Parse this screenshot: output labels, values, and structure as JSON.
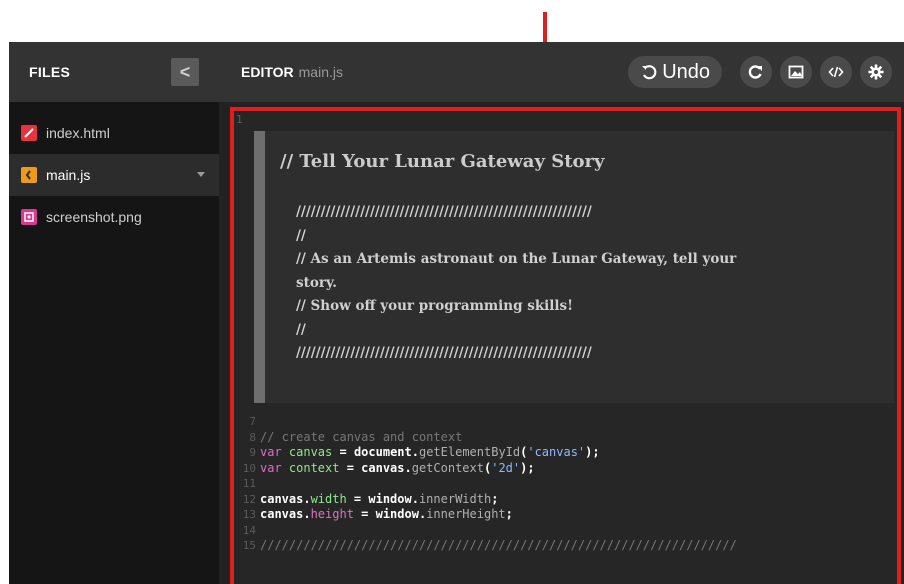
{
  "sidebar": {
    "title": "FILES",
    "collapse_glyph": "<",
    "files": [
      {
        "name": "index.html",
        "icon": "html-file-icon",
        "color": "#e8323c",
        "active": false
      },
      {
        "name": "main.js",
        "icon": "js-file-icon",
        "color": "#f09a1a",
        "active": true
      },
      {
        "name": "screenshot.png",
        "icon": "image-file-icon",
        "color": "#d6398f",
        "active": false
      }
    ]
  },
  "editor": {
    "label": "EDITOR",
    "filename": "main.js",
    "undo_label": "Undo",
    "tools": [
      "refresh-icon",
      "image-icon",
      "code-icon",
      "gear-icon"
    ]
  },
  "code": {
    "first_line_number": "1",
    "comment_title": "// Tell Your Lunar Gateway Story",
    "comment_lines": [
      "////////////////////////////////////////////////////////////",
      "//",
      "// As an Artemis astronaut on the Lunar Gateway, tell your",
      "story.",
      "// Show off your programming skills!",
      "//",
      "////////////////////////////////////////////////////////////"
    ],
    "lines": [
      {
        "n": "7",
        "parts": []
      },
      {
        "n": "8",
        "parts": [
          {
            "c": "c-com",
            "t": "// create canvas and context"
          }
        ]
      },
      {
        "n": "9",
        "parts": [
          {
            "c": "c-kw",
            "t": "var "
          },
          {
            "c": "c-var",
            "t": "canvas"
          },
          {
            "c": "c-punc",
            "t": " = document."
          },
          {
            "c": "c-fn",
            "t": "getElementById"
          },
          {
            "c": "c-punc",
            "t": "("
          },
          {
            "c": "c-str",
            "t": "'canvas'"
          },
          {
            "c": "c-punc",
            "t": ");"
          }
        ]
      },
      {
        "n": "10",
        "parts": [
          {
            "c": "c-kw",
            "t": "var "
          },
          {
            "c": "c-var",
            "t": "context"
          },
          {
            "c": "c-punc",
            "t": " = canvas."
          },
          {
            "c": "c-fn",
            "t": "getContext"
          },
          {
            "c": "c-punc",
            "t": "("
          },
          {
            "c": "c-str",
            "t": "'2d'"
          },
          {
            "c": "c-punc",
            "t": ");"
          }
        ]
      },
      {
        "n": "11",
        "parts": []
      },
      {
        "n": "12",
        "parts": [
          {
            "c": "c-punc",
            "t": "canvas."
          },
          {
            "c": "c-var",
            "t": "width"
          },
          {
            "c": "c-punc",
            "t": " = window."
          },
          {
            "c": "c-fn",
            "t": "innerWidth"
          },
          {
            "c": "c-punc",
            "t": ";"
          }
        ]
      },
      {
        "n": "13",
        "parts": [
          {
            "c": "c-punc",
            "t": "canvas."
          },
          {
            "c": "c-kw",
            "t": "height"
          },
          {
            "c": "c-punc",
            "t": " = window."
          },
          {
            "c": "c-fn",
            "t": "innerHeight"
          },
          {
            "c": "c-punc",
            "t": ";"
          }
        ]
      },
      {
        "n": "14",
        "parts": []
      },
      {
        "n": "15",
        "parts": [
          {
            "c": "c-com",
            "t": "//////////////////////////////////////////////////////////////////"
          }
        ]
      }
    ]
  },
  "colors": {
    "highlight": "#e01e1e",
    "panel": "#333333"
  }
}
